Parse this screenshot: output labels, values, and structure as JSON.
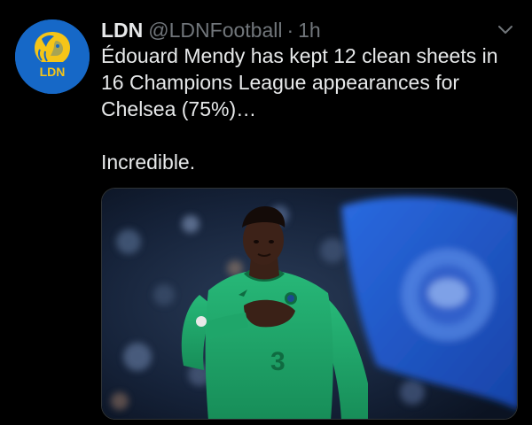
{
  "tweet": {
    "display_name": "LDN",
    "handle": "@LDNFootball",
    "separator": "·",
    "time": "1h",
    "text_lines": [
      "Édouard Mendy has kept 12 clean sheets in 16 Champions League appearances for Chelsea (75%)…",
      "Incredible."
    ],
    "avatar": {
      "logo_text": "LDN",
      "icon": "lion-head-icon",
      "background": "#1668c7",
      "logo_color": "#f5c518"
    },
    "menu_icon": "chevron-down-icon",
    "media": {
      "description_icon": "photo-image",
      "shirt_color": "#1fa66a",
      "flag_color": "#1e56c9"
    }
  },
  "colors": {
    "background": "#000000",
    "text_primary": "#e7e9ea",
    "text_secondary": "#71767b"
  }
}
